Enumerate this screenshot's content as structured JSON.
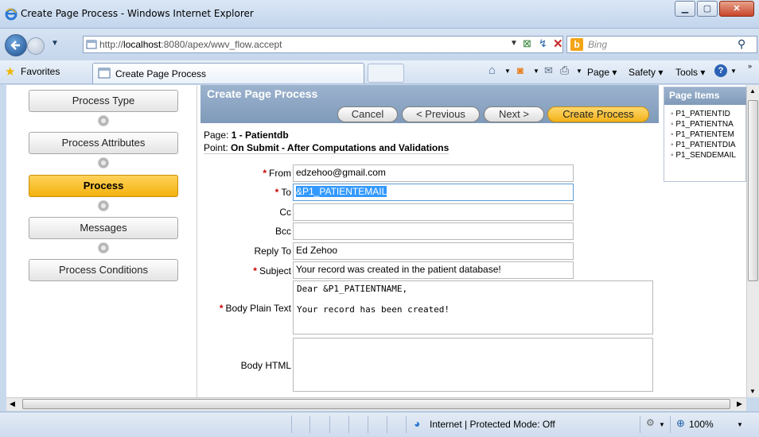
{
  "window": {
    "title": "Create Page Process - Windows Internet Explorer"
  },
  "address": {
    "url_prefix": "http://",
    "url_host": "localhost",
    "url_rest": ":8080/apex/wwv_flow.accept",
    "search_placeholder": "Bing"
  },
  "commandbar": {
    "favorites": "Favorites",
    "tab_title": "Create Page Process",
    "page_menu": "Page ▾",
    "safety_menu": "Safety ▾",
    "tools_menu": "Tools ▾"
  },
  "wizard": {
    "steps": [
      "Process Type",
      "Process Attributes",
      "Process",
      "Messages",
      "Process Conditions"
    ],
    "active_step": "Process"
  },
  "form": {
    "region_title": "Create Page Process",
    "buttons": {
      "cancel": "Cancel",
      "previous": "< Previous",
      "next": "Next >",
      "create": "Create Process"
    },
    "page_label": "Page:",
    "page_value": "1 - Patientdb",
    "point_label": "Point:",
    "point_value": "On Submit - After Computations and Validations",
    "from_label": "From",
    "from_value": "edzehoo@gmail.com",
    "to_label": "To",
    "to_value": "&P1_PATIENTEMAIL",
    "cc_label": "Cc",
    "cc_value": "",
    "bcc_label": "Bcc",
    "bcc_value": "",
    "replyto_label": "Reply To",
    "replyto_value": "Ed Zehoo",
    "subject_label": "Subject",
    "subject_value": "Your record was created in the patient database!",
    "body_plain_label": "Body Plain Text",
    "body_plain_line1": "Dear &P1_PATIENTNAME,",
    "body_plain_line2": "Your record has been created!",
    "body_html_label": "Body HTML"
  },
  "page_items": {
    "title": "Page Items",
    "items": [
      "P1_PATIENTID",
      "P1_PATIENTNA",
      "P1_PATIENTEM",
      "P1_PATIENTDIA",
      "P1_SENDEMAIL"
    ]
  },
  "status": {
    "zone": "Internet | Protected Mode: Off",
    "zoom": "100%"
  }
}
